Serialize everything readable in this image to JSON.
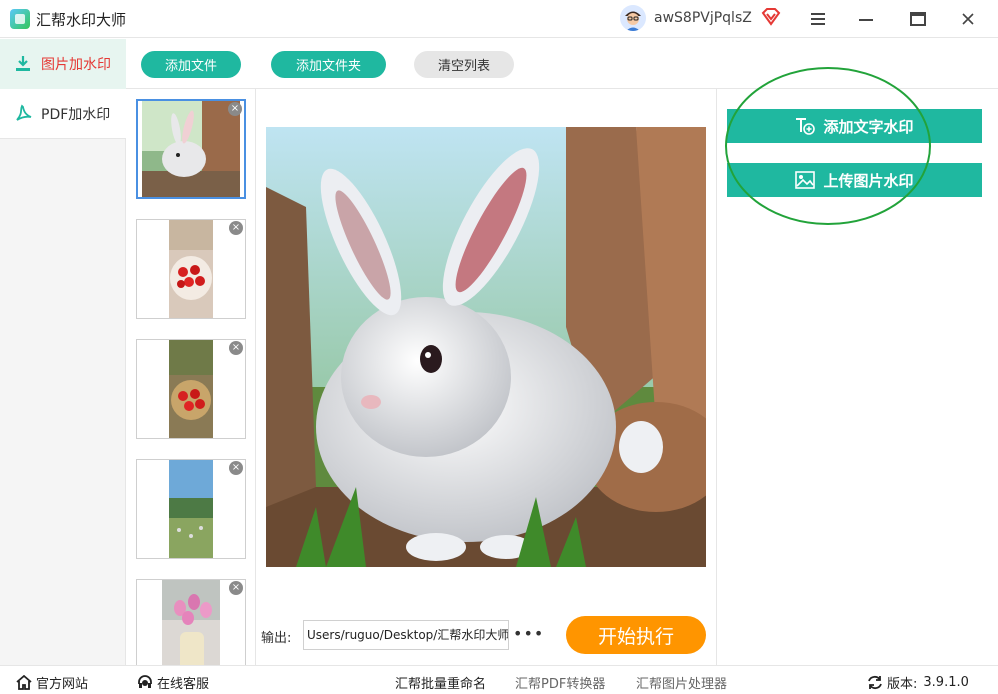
{
  "app": {
    "title": "汇帮水印大师"
  },
  "user": {
    "name": "awS8PVjPqlsZ"
  },
  "sidebar": {
    "items": [
      {
        "label": "图片加水印"
      },
      {
        "label": "PDF加水印"
      }
    ]
  },
  "toolbar": {
    "add_file": "添加文件",
    "add_folder": "添加文件夹",
    "clear_list": "清空列表"
  },
  "thumbnails": [
    {
      "subject": "rabbit",
      "selected": true
    },
    {
      "subject": "strawberries-plate"
    },
    {
      "subject": "strawberries-basket"
    },
    {
      "subject": "hillside"
    },
    {
      "subject": "tulips-vase"
    }
  ],
  "preview": {
    "subject": "white-rabbit"
  },
  "output": {
    "label": "输出:",
    "path": "Users/ruguo/Desktop/汇帮水印大师"
  },
  "actions": {
    "start": "开始执行",
    "add_text_watermark": "添加文字水印",
    "upload_image_watermark": "上传图片水印"
  },
  "footer": {
    "website": "官方网站",
    "support": "在线客服",
    "rename": "汇帮批量重命名",
    "pdf_converter": "汇帮PDF转换器",
    "image_processor": "汇帮图片处理器",
    "version_label": "版本:",
    "version": "3.9.1.0"
  },
  "colors": {
    "teal": "#1fb8a0",
    "orange": "#ff9500",
    "active_red": "#e53935",
    "annotation_green": "#22a33a"
  }
}
